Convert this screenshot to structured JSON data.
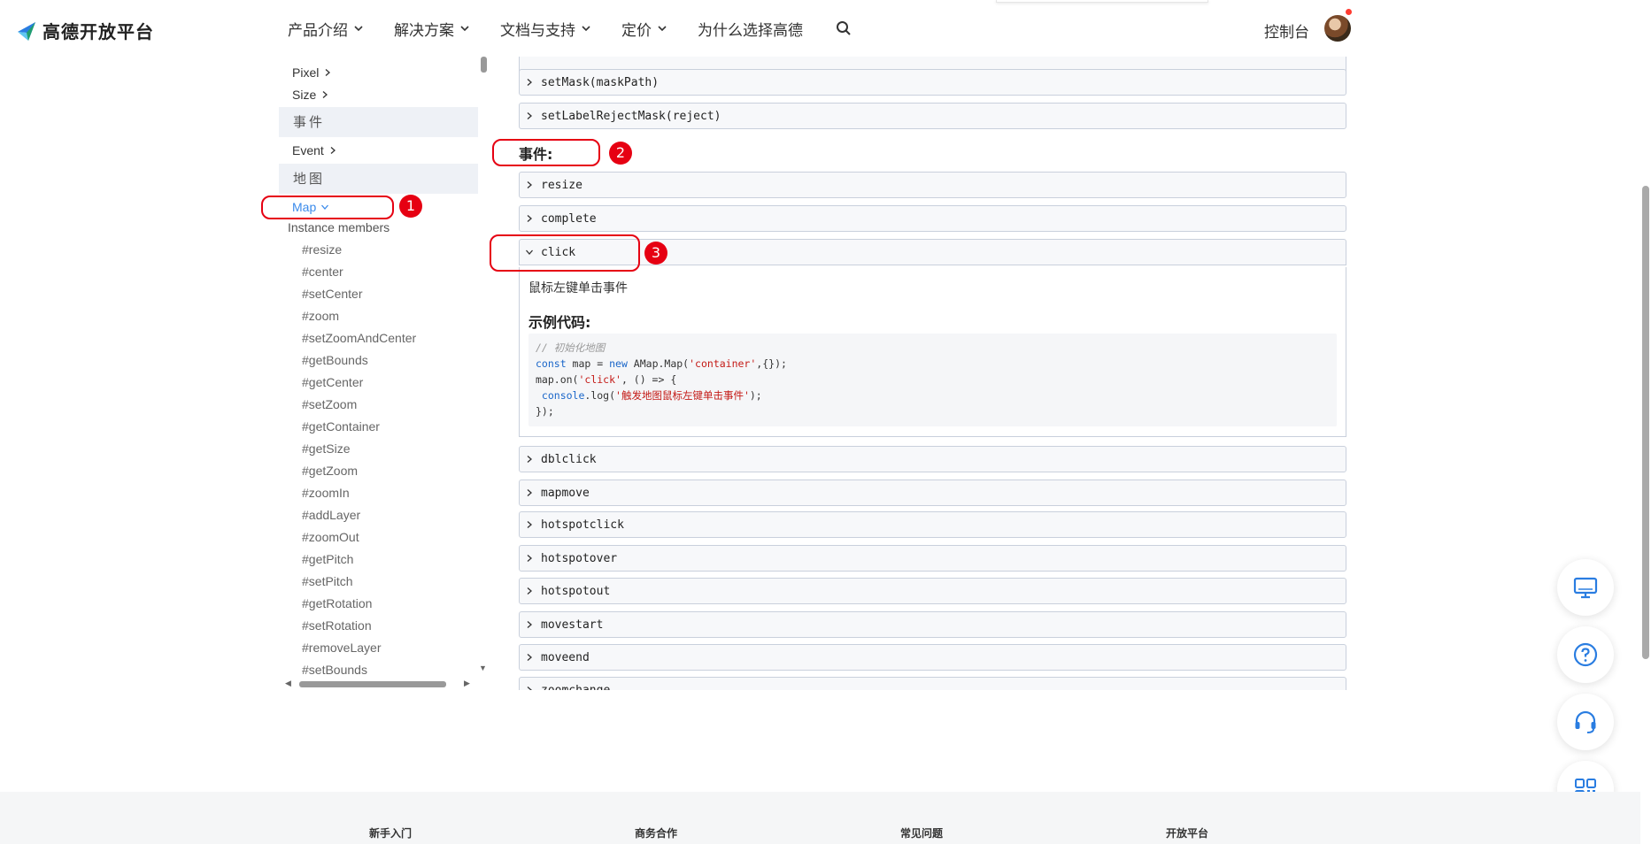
{
  "header": {
    "brand": "高德开放平台",
    "nav": [
      {
        "label": "产品介绍",
        "dropdown": true
      },
      {
        "label": "解决方案",
        "dropdown": true
      },
      {
        "label": "文档与支持",
        "dropdown": true
      },
      {
        "label": "定价",
        "dropdown": true
      },
      {
        "label": "为什么选择高德",
        "dropdown": false
      }
    ],
    "console": "控制台"
  },
  "sidebar": {
    "top_links": [
      "Pixel",
      "Size"
    ],
    "section_events": "事件",
    "event_link": "Event",
    "section_map": "地图",
    "map_link": "Map",
    "instance_members": "Instance members",
    "members": [
      "#resize",
      "#center",
      "#setCenter",
      "#zoom",
      "#setZoomAndCenter",
      "#getBounds",
      "#getCenter",
      "#setZoom",
      "#getContainer",
      "#getSize",
      "#getZoom",
      "#zoomIn",
      "#addLayer",
      "#zoomOut",
      "#getPitch",
      "#setPitch",
      "#getRotation",
      "#setRotation",
      "#removeLayer",
      "#setBounds"
    ]
  },
  "main": {
    "methods": [
      "setMask(maskPath)",
      "setLabelRejectMask(reject)"
    ],
    "events_heading": "事件:",
    "events": [
      "resize",
      "complete",
      "click",
      "dblclick",
      "mapmove",
      "hotspotclick",
      "hotspotover",
      "hotspotout",
      "movestart",
      "moveend",
      "zoomchange"
    ],
    "click_detail": {
      "description": "鼠标左键单击事件",
      "example_heading": "示例代码:",
      "code": {
        "line1": "// 初始化地图",
        "line2_a": "const",
        "line2_b": " map = ",
        "line2_c": "new",
        "line2_d": " AMap.Map(",
        "line2_e": "'container'",
        "line2_f": ",{});",
        "line3_a": "map.on(",
        "line3_b": "'click'",
        "line3_c": ", () => {",
        "line4_a": " console",
        "line4_b": ".log(",
        "line4_c": "'触发地图鼠标左键单击事件'",
        "line4_d": ");",
        "line5": "});"
      }
    }
  },
  "annotations": [
    "1",
    "2",
    "3"
  ],
  "footer": {
    "columns": [
      "新手入门",
      "商务合作",
      "常见问题",
      "开放平台"
    ]
  },
  "colors": {
    "accent": "#3b8beb",
    "annotation": "#e60012",
    "section_bg": "#eef1f6"
  }
}
